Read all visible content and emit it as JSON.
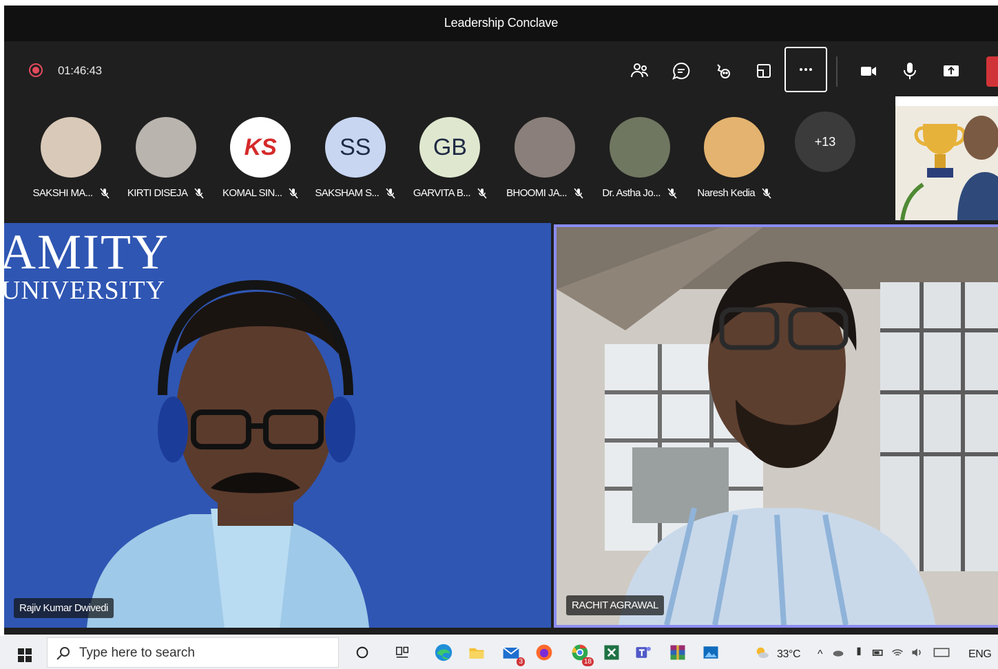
{
  "window": {
    "title": "Leadership Conclave"
  },
  "meeting": {
    "timer": "01:46:43",
    "controls": [
      {
        "name": "people",
        "icon": "people-icon"
      },
      {
        "name": "chat",
        "icon": "chat-icon"
      },
      {
        "name": "reactions",
        "icon": "reactions-icon"
      },
      {
        "name": "rooms",
        "icon": "rooms-icon"
      },
      {
        "name": "more",
        "icon": "more-icon"
      },
      {
        "name": "camera",
        "icon": "camera-icon"
      },
      {
        "name": "mic",
        "icon": "mic-icon"
      },
      {
        "name": "share",
        "icon": "share-icon"
      },
      {
        "name": "leave",
        "icon": "leave-icon"
      }
    ],
    "accent_color": "#8b8cf0",
    "leave_color": "#d13438",
    "recording_color": "#e34a5c"
  },
  "participants": [
    {
      "name": "SAKSHI MA...",
      "initials": "",
      "avatar_color": "#d9c9b8",
      "muted": true
    },
    {
      "name": "KIRTI DISEJA",
      "initials": "",
      "avatar_color": "#b9b4ae",
      "muted": true
    },
    {
      "name": "KOMAL SIN...",
      "initials": "KS",
      "avatar_color": "#ffffff",
      "muted": true
    },
    {
      "name": "SAKSHAM S...",
      "initials": "SS",
      "avatar_color": "#c8d6f2",
      "muted": true
    },
    {
      "name": "GARVITA B...",
      "initials": "GB",
      "avatar_color": "#dfe8cf",
      "muted": true
    },
    {
      "name": "BHOOMI JA...",
      "initials": "",
      "avatar_color": "#8a7f7a",
      "muted": true
    },
    {
      "name": "Dr. Astha Jo...",
      "initials": "",
      "avatar_color": "#6f7760",
      "muted": true
    },
    {
      "name": "Naresh Kedia",
      "initials": "",
      "avatar_color": "#e3b36f",
      "muted": true
    }
  ],
  "overflow_count": "+13",
  "videos": {
    "left": {
      "brand_line1": "AMITY",
      "brand_line2": "UNIVERSITY",
      "name": "Rajiv Kumar Dwivedi",
      "bg_color": "#2f56b3"
    },
    "right": {
      "name": "RACHIT AGRAWAL"
    }
  },
  "taskbar": {
    "search_placeholder": "Type here to search",
    "mail_badge": "3",
    "chrome_badge": "18",
    "temperature": "33°C",
    "language": "ENG"
  }
}
